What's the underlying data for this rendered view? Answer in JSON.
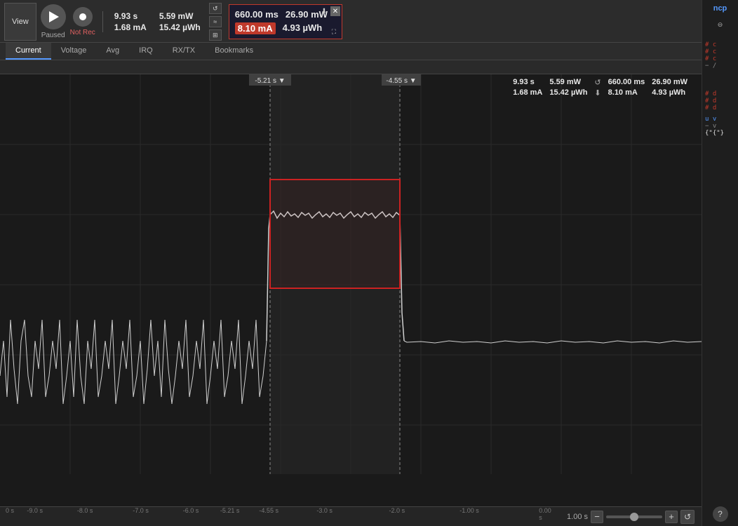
{
  "app": {
    "title": "ncp",
    "logo_text": "ncp"
  },
  "toolbar": {
    "play_label": "▶",
    "stop_label": "●",
    "paused_label": "Paused",
    "not_rec_label": "Not Rec",
    "view_label": "View",
    "refresh_icon": "↺",
    "time1": "9.93 s",
    "power1": "5.59 mW",
    "current1": "1.68 mA",
    "energy1": "15.42 µWh",
    "measure_time": "660.00 ms",
    "measure_power1": "26.90 mW",
    "measure_current": "8.10 mA",
    "measure_energy": "4.93 µWh",
    "close_label": "✕",
    "download_icon": "⬇",
    "fit_icon": "⛶"
  },
  "tabs": {
    "items": [
      "Current",
      "Voltage",
      "Avg",
      "IRQ",
      "RX/TX",
      "Bookmarks"
    ],
    "active": "Current"
  },
  "chart": {
    "cursor1_label": "-5.21 s",
    "cursor2_label": "-4.55 s",
    "stats": {
      "time1": "9.93 s",
      "power1": "5.59 mW",
      "refresh1": "↺",
      "range_time": "660.00 ms",
      "range_power": "26.90 mW",
      "current1": "1.68 mA",
      "energy1": "15.42 µWh",
      "download1": "⬇",
      "range_current": "8.10 mA",
      "range_energy": "4.93 µWh",
      "download2": "⬇"
    }
  },
  "timeline": {
    "labels": [
      "-9.0 s",
      "-8.0 s",
      "-7.0 s",
      "-6.0 s",
      "-5.21 s",
      "-4.55 s",
      "-3.0 s",
      "-2.0 s",
      "-1.00 s",
      "0.00 s"
    ],
    "positions": [
      5,
      14,
      24,
      33,
      40,
      47,
      57,
      70,
      83,
      97
    ],
    "zoom_value": "1.00 s",
    "zoom_minus": "−",
    "zoom_plus": "+"
  },
  "help": {
    "label": "?"
  },
  "code_panel": {
    "lines": [
      "# c",
      "# c",
      "# c",
      "− /",
      "# d",
      "# d",
      "# d",
      "u v",
      "− v",
      "{"
    ]
  }
}
